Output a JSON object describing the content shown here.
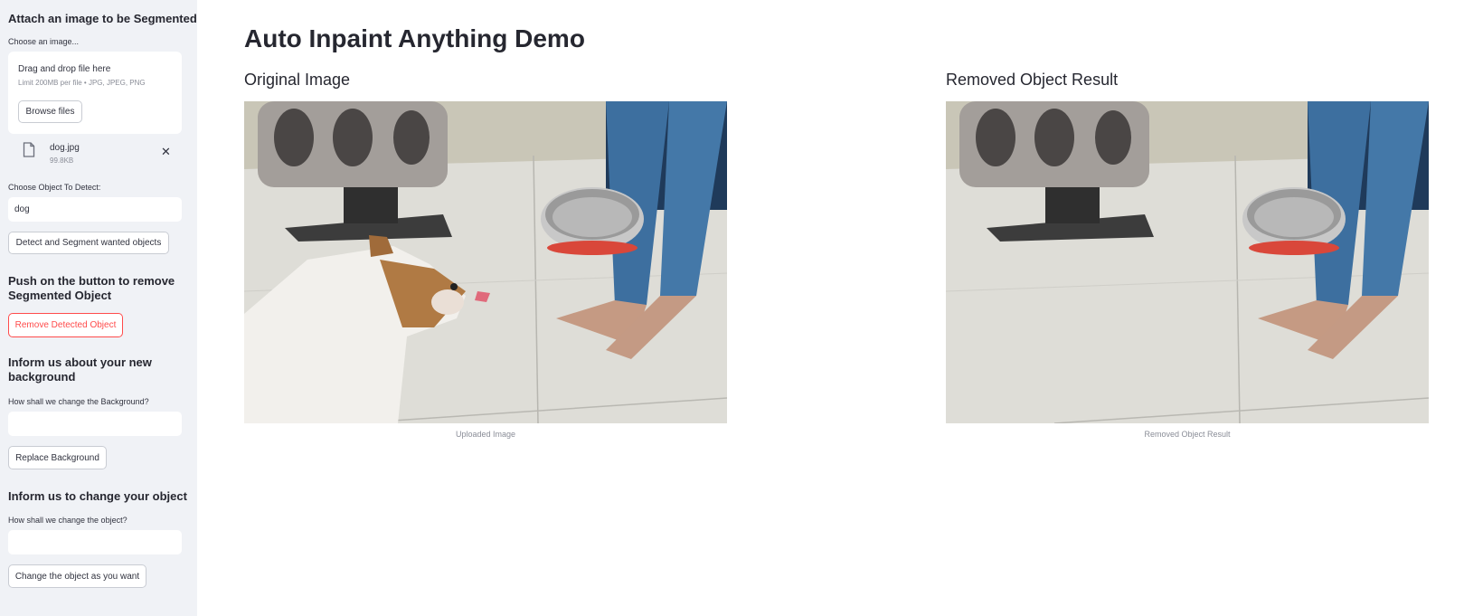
{
  "sidebar": {
    "attach_heading": "Attach an image to be Segmented",
    "choose_image_label": "Choose an image...",
    "uploader": {
      "drag_text": "Drag and drop file here",
      "limit_text": "Limit 200MB per file • JPG, JPEG, PNG",
      "browse_label": "Browse files"
    },
    "file": {
      "name": "dog.jpg",
      "size": "99.8KB"
    },
    "detect_label": "Choose Object To Detect:",
    "detect_value": "dog",
    "detect_button": "Detect and Segment wanted objects",
    "remove_heading": "Push on the button to remove Segmented Object",
    "remove_button": "Remove Detected Object",
    "background_heading": "Inform us about your new background",
    "background_label": "How shall we change the Background?",
    "background_value": "",
    "replace_button": "Replace Background",
    "object_heading": "Inform us to change your object",
    "object_label": "How shall we change the object?",
    "object_value": "",
    "change_button": "Change the object as you want"
  },
  "main": {
    "title": "Auto Inpaint Anything Demo",
    "original": {
      "heading": "Original Image",
      "caption": "Uploaded Image"
    },
    "result": {
      "heading": "Removed Object Result",
      "caption": "Removed Object Result"
    }
  },
  "colors": {
    "accent_red": "#ff4b4b",
    "sidebar_bg": "#f0f2f6"
  },
  "icons": {
    "file": "file-icon",
    "close": "close-icon"
  }
}
